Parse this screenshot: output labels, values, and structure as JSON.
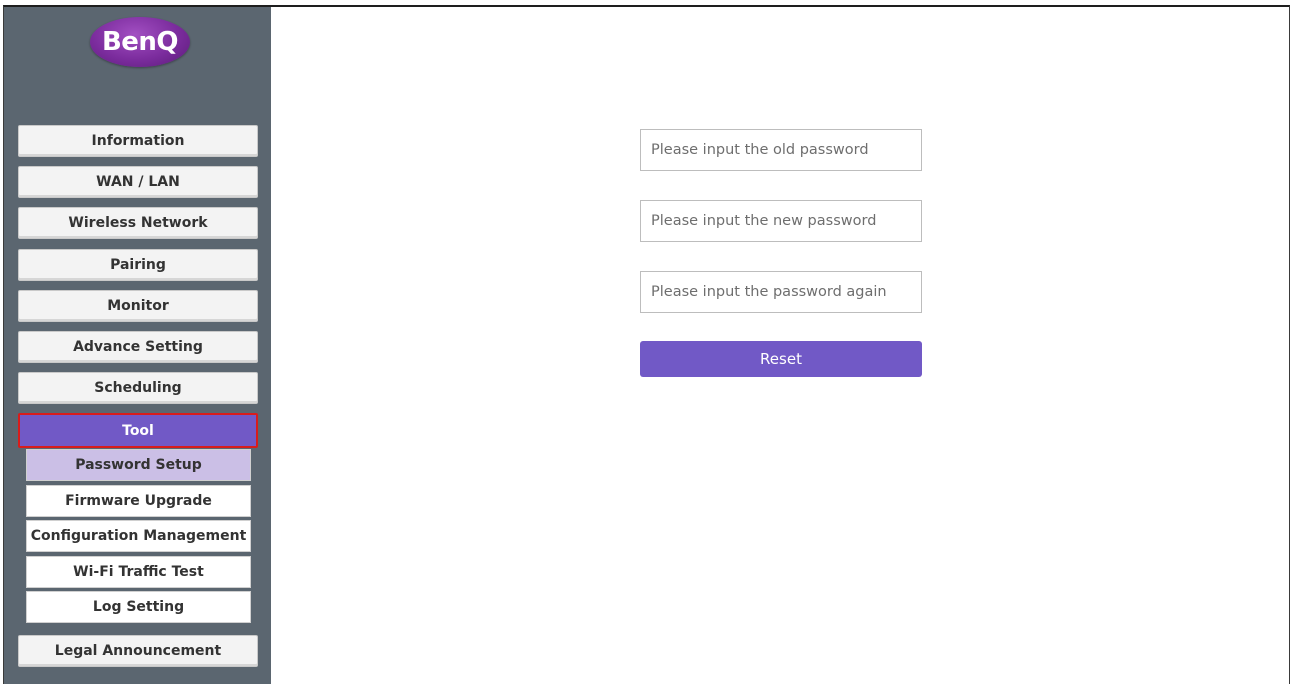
{
  "brand": {
    "logo_text": "BenQ",
    "logo_color": "#7b2c9d"
  },
  "colors": {
    "accent": "#7159c6",
    "sidebar_bg": "#5b6670",
    "active_outline": "#d81c1c",
    "submenu_selected": "#cbbfe6"
  },
  "sidebar": {
    "items": [
      {
        "label": "Information"
      },
      {
        "label": "WAN / LAN"
      },
      {
        "label": "Wireless Network"
      },
      {
        "label": "Pairing"
      },
      {
        "label": "Monitor"
      },
      {
        "label": "Advance Setting"
      },
      {
        "label": "Scheduling"
      },
      {
        "label": "Tool",
        "active": true
      },
      {
        "label": "Legal Announcement"
      }
    ],
    "tool_submenu": [
      {
        "label": "Password Setup",
        "selected": true
      },
      {
        "label": "Firmware Upgrade"
      },
      {
        "label": "Configuration Management"
      },
      {
        "label": "Wi-Fi Traffic Test"
      },
      {
        "label": "Log Setting"
      }
    ]
  },
  "form": {
    "old_password_placeholder": "Please input the old password",
    "new_password_placeholder": "Please input the new password",
    "confirm_password_placeholder": "Please input the password again",
    "reset_label": "Reset"
  }
}
